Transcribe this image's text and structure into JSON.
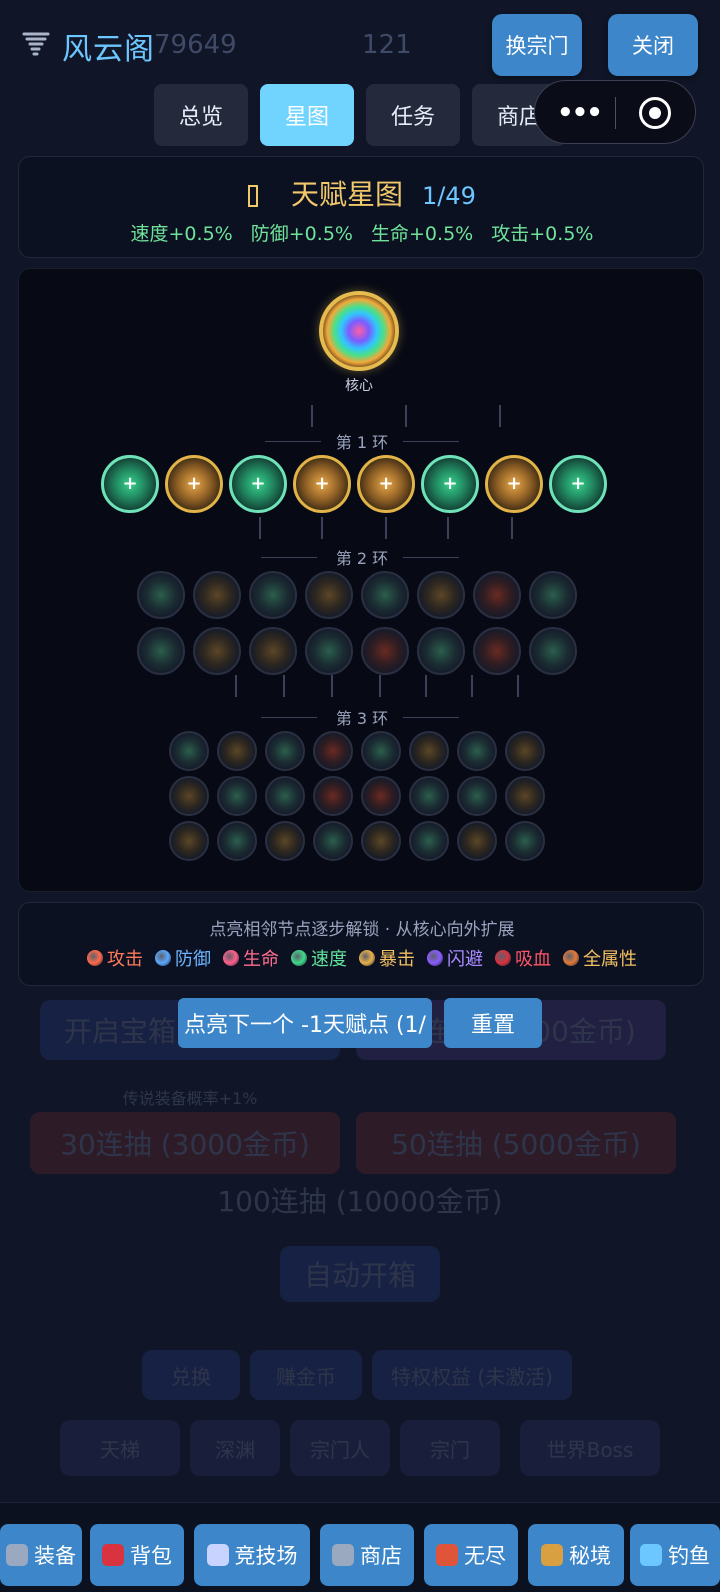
{
  "app": {
    "title": "风云阁",
    "icon": "tornado-icon"
  },
  "header_faded": {
    "coins": "79649",
    "gems": "121"
  },
  "header_buttons": {
    "switch_sect": "换宗门",
    "close": "关闭"
  },
  "tabs": [
    {
      "label": "总览",
      "active": false
    },
    {
      "label": "星图",
      "active": true
    },
    {
      "label": "任务",
      "active": false
    },
    {
      "label": "商店",
      "active": false
    }
  ],
  "talent": {
    "title": "天赋星图",
    "progress": "1/49",
    "bonuses": [
      "速度+0.5%",
      "防御+0.5%",
      "生命+0.5%",
      "攻击+0.5%"
    ]
  },
  "star_map": {
    "core_label": "核心",
    "ring1_label": "第 1 环",
    "ring2_label": "第 2 环",
    "ring3_label": "第 3 环",
    "ring1_nodes": [
      "green",
      "gold",
      "green",
      "gold",
      "gold",
      "green",
      "gold",
      "green"
    ],
    "ring2_rows": [
      [
        "g",
        "y",
        "g",
        "y",
        "g",
        "y",
        "r",
        "g"
      ],
      [
        "g",
        "y",
        "y",
        "g",
        "r",
        "g",
        "r",
        "g"
      ]
    ],
    "ring3_rows": [
      [
        "g",
        "y",
        "g",
        "r",
        "g",
        "y",
        "g",
        "y"
      ],
      [
        "y",
        "g",
        "g",
        "r",
        "r",
        "g",
        "g",
        "y"
      ],
      [
        "y",
        "g",
        "y",
        "g",
        "y",
        "g",
        "y",
        "g"
      ]
    ]
  },
  "legend": {
    "hint": "点亮相邻节点逐步解锁 · 从核心向外扩展",
    "items": [
      {
        "label": "攻击",
        "color": "#ff6a4a",
        "text_color": "#ff7a5a"
      },
      {
        "label": "防御",
        "color": "#5aa8ff",
        "text_color": "#6cb4ff"
      },
      {
        "label": "生命",
        "color": "#ff5f8a",
        "text_color": "#ff6f8f"
      },
      {
        "label": "速度",
        "color": "#3fd98a",
        "text_color": "#5fe29a"
      },
      {
        "label": "暴击",
        "color": "#e8b04a",
        "text_color": "#f1c060"
      },
      {
        "label": "闪避",
        "color": "#8a5cff",
        "text_color": "#a98cff"
      },
      {
        "label": "吸血",
        "color": "#d8333f",
        "text_color": "#ff5566"
      },
      {
        "label": "全属性",
        "color": "#e07a3a",
        "text_color": "#f1c060"
      }
    ]
  },
  "actions": {
    "light_next": "点亮下一个 -1天赋点 (1/",
    "reset": "重置"
  },
  "bottom_nav": [
    {
      "label": "装备",
      "icon": "swords-icon"
    },
    {
      "label": "背包",
      "icon": "backpack-icon"
    },
    {
      "label": "竞技场",
      "icon": "arena-icon"
    },
    {
      "label": "商店",
      "icon": "cart-icon"
    },
    {
      "label": "无尽",
      "icon": "tower-icon"
    },
    {
      "label": "秘境",
      "icon": "pickaxe-icon"
    },
    {
      "label": "钓鱼",
      "icon": "fishing-icon"
    }
  ],
  "colors": {
    "accent": "#3c86c9",
    "tab_active": "#71d4ff",
    "gold": "#f1c86a",
    "green": "#6fe39a"
  },
  "background_faded": {
    "chest_open": "开启宝箱 (100金币)",
    "draw_10": "10连抽 (1000金币)",
    "rare_bonus": "传说装备概率+1%",
    "draw_30": "30连抽 (3000金币)",
    "draw_50": "50连抽 (5000金币)",
    "draw_100": "100连抽 (10000金币)",
    "auto_open": "自动开箱",
    "exchange": "兑换",
    "earn_coins": "赚金币",
    "privilege": "特权权益 (未激活)",
    "row_a": "天梯",
    "row_b": "深渊",
    "row_c": "宗门人",
    "row_d": "宗门",
    "row_e": "世界Boss"
  }
}
